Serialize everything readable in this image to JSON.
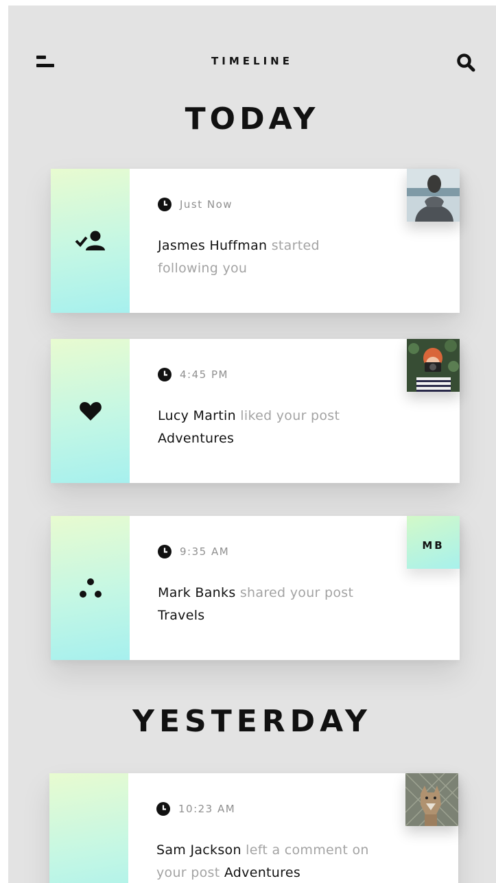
{
  "header": {
    "title": "TIMELINE",
    "menu_icon": "hamburger-menu-icon",
    "search_icon": "search-icon"
  },
  "sections": {
    "today": "TODAY",
    "yesterday": "YESTERDAY"
  },
  "colors": {
    "background": "#e3e3e3",
    "card": "#ffffff",
    "accent_gradient_start": "#e8fbd0",
    "accent_gradient_end": "#a6f0ee",
    "muted_text": "#a3a3a3",
    "strong_text": "#111111"
  },
  "notifications": [
    {
      "icon": "user-check-icon",
      "time": "Just Now",
      "name": "Jasmes Huffman",
      "action": " started following you",
      "target": "",
      "thumbnail": "photo"
    },
    {
      "icon": "heart-icon",
      "time": "4:45 PM",
      "name": "Lucy Martin",
      "action": " liked your post ",
      "target": "Adventures",
      "thumbnail": "photo"
    },
    {
      "icon": "share-icon",
      "time": "9:35 AM",
      "name": "Mark Banks",
      "action": " shared your post ",
      "target": "Travels",
      "thumbnail_initials": "MB"
    },
    {
      "icon": "comment-icon",
      "time": "10:23 AM",
      "name": "Sam Jackson",
      "action": " left a comment on your post ",
      "target": "Adventures",
      "thumbnail": "photo"
    }
  ]
}
